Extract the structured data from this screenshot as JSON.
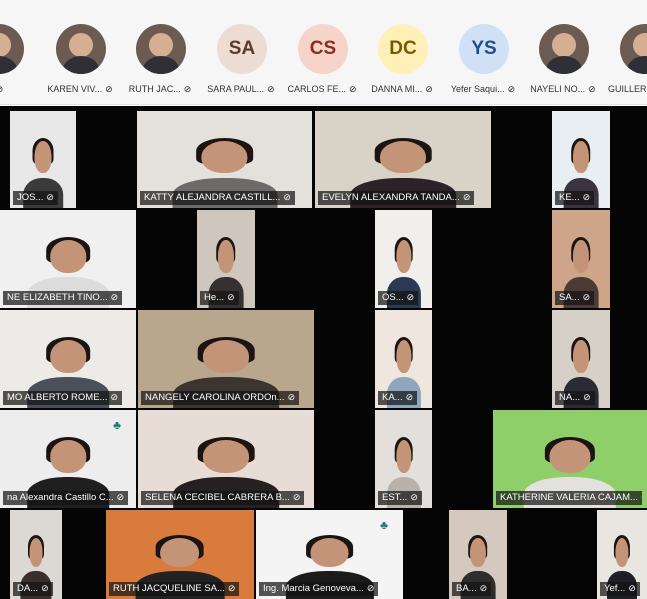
{
  "participant_strip": [
    {
      "label": "",
      "initials": "",
      "avatar": "photo"
    },
    {
      "label": "KAREN VIV...",
      "initials": "",
      "avatar": "photo"
    },
    {
      "label": "RUTH JAC...",
      "initials": "",
      "avatar": "photo"
    },
    {
      "label": "SARA PAUL...",
      "initials": "SA",
      "avatar": "initials",
      "bg": "#ecdcd3",
      "fg": "#5a3d30"
    },
    {
      "label": "CARLOS FE...",
      "initials": "CS",
      "avatar": "initials",
      "bg": "#f7d4c9",
      "fg": "#8a2e1d"
    },
    {
      "label": "DANNA MI...",
      "initials": "DC",
      "avatar": "initials",
      "bg": "#fff0b8",
      "fg": "#7a5a00"
    },
    {
      "label": "Yefer Saqui...",
      "initials": "YS",
      "avatar": "initials",
      "bg": "#cfe0f7",
      "fg": "#1f4e8c"
    },
    {
      "label": "NAYELI NO...",
      "initials": "",
      "avatar": "photo"
    },
    {
      "label": "GUILLERM",
      "initials": "",
      "avatar": "photo"
    }
  ],
  "video_tiles": [
    {
      "name": "JOS...",
      "bg": "#e8e8e8",
      "shirt": "#3b3b3b"
    },
    {
      "name": "KATTY ALEJANDRA CASTILL...",
      "bg": "#e4e1dc",
      "shirt": "#6e6a68"
    },
    {
      "name": "EVELYN ALEXANDRA TANDA...",
      "bg": "#d9d2c6",
      "shirt": "#2c2228"
    },
    {
      "name": "KE...",
      "bg": "#e9eef3",
      "shirt": "#3a3340"
    },
    {
      "name": "NE ELIZABETH TINO...",
      "bg": "#f0f0f0",
      "shirt": "#dcdcdc"
    },
    {
      "name": "He...",
      "bg": "#cfc7bd",
      "shirt": "#36302f"
    },
    {
      "name": "OS...",
      "bg": "#f1efec",
      "shirt": "#2a3a55"
    },
    {
      "name": "SA...",
      "bg": "#cfa58a",
      "shirt": "#4b3a36"
    },
    {
      "name": "MO ALBERTO ROME...",
      "bg": "#ecebe7",
      "shirt": "#4a4f5c"
    },
    {
      "name": "NANGELY CAROLINA ORDOn...",
      "bg": "#b9a78d",
      "shirt": "#3b3431"
    },
    {
      "name": "KA...",
      "bg": "#efe7df",
      "shirt": "#8fa6bf"
    },
    {
      "name": "NA...",
      "bg": "#d7d0c8",
      "shirt": "#2b2b35"
    },
    {
      "name": "na Alexandra Castillo C...",
      "bg": "#ededed",
      "shirt": "#1f1f1f"
    },
    {
      "name": "SELENA CECIBEL  CABRERA B...",
      "bg": "#e7ddd6",
      "shirt": "#262022"
    },
    {
      "name": "EST...",
      "bg": "#e2dfdc",
      "shirt": "#b8b2aa"
    },
    {
      "name": "KATHERINE VALERIA CAJAM...",
      "bg": "#8fcf6a",
      "shirt": "#e3e0de"
    },
    {
      "name": "DA...",
      "bg": "#dcd8d3",
      "shirt": "#3a2f2c"
    },
    {
      "name": "RUTH JACQUELINE SA...",
      "bg": "#d97b3c",
      "shirt": "#222222"
    },
    {
      "name": "Ing. Marcia Genoveva...",
      "bg": "#f4f4f4",
      "shirt": "#1b1b1b"
    },
    {
      "name": "BA...",
      "bg": "#d5c9bf",
      "shirt": "#2d2d2d"
    },
    {
      "name": "Yef...",
      "bg": "#e9e6e2",
      "shirt": "#1f1f28"
    }
  ],
  "icons": {
    "mic": "mic-muted-icon",
    "logo": "leaf-logo-icon"
  }
}
